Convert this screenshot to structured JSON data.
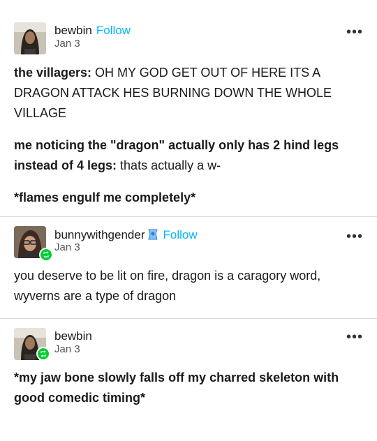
{
  "posts": [
    {
      "username": "bewbin",
      "follow_label": "Follow",
      "date": "Jan 3",
      "more_label": "•••",
      "paragraphs": [
        {
          "bold": "the villagers:",
          "text": " OH MY GOD GET OUT OF HERE ITS A DRAGON ATTACK HES BURNING DOWN THE WHOLE VILLAGE"
        },
        {
          "bold": "me noticing the \"dragon\" actually only has 2 hind legs instead of 4 legs:",
          "text": " thats actually a w-"
        },
        {
          "bold": "*flames engulf me completely*",
          "text": ""
        }
      ]
    },
    {
      "username": "bunnywithgender",
      "follow_label": "Follow",
      "date": "Jan 3",
      "more_label": "•••",
      "paragraphs": [
        {
          "bold": "",
          "text": "you deserve to be lit on fire, dragon is a caragory word, wyverns are a type of dragon"
        }
      ]
    },
    {
      "username": "bewbin",
      "date": "Jan 3",
      "more_label": "•••",
      "paragraphs": [
        {
          "bold": "*my jaw bone slowly falls off my charred skeleton with good comedic timing*",
          "text": ""
        }
      ]
    }
  ],
  "icons": {
    "more": "more-options-icon",
    "reblog": "reblog-icon",
    "badge": "verified-badge-icon"
  },
  "colors": {
    "follow": "#00b8ff",
    "reblog": "#00cf35",
    "divider": "#d9d9d9"
  }
}
